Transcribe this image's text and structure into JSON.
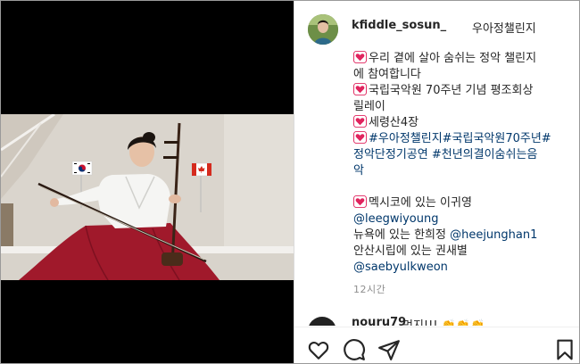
{
  "post": {
    "author": "kfiddle_sosun_",
    "author_title": "우아정챌린지"
  },
  "caption": {
    "l1": "우리 곁에 살아 숨쉬는 정악 챌린지",
    "l2": "에 참여합니다",
    "l3": "국립국악원 70주년 기념 평조회상",
    "l4": "릴레이",
    "l5": "세령산4장",
    "l6": "#우아정챌린지#국립국악원70주년#",
    "l7": "정악단정기공연 #천년의결이숨쉬는음",
    "l8": "악",
    "l9": "멕시코에 있는 이귀영",
    "l10": "@leegwiyoung",
    "l11_a": "뉴욕에 있는 한희정 ",
    "l11_b": "@heejunghan1",
    "l12": "안산시립에 있는 권새별",
    "l13": "@saebyulkweon"
  },
  "time": "12시간",
  "comment": {
    "user": "nouru79",
    "text": "멋지!!! 👏👏👏"
  },
  "icons": {
    "like": "heart-outline-icon",
    "comment": "comment-bubble-icon",
    "share": "paper-plane-icon",
    "save": "bookmark-icon",
    "caption_bullet": "heart-emoji-icon"
  },
  "colors": {
    "link": "#00376b",
    "heart": "#e0245e",
    "muted": "#8e8e8e"
  }
}
